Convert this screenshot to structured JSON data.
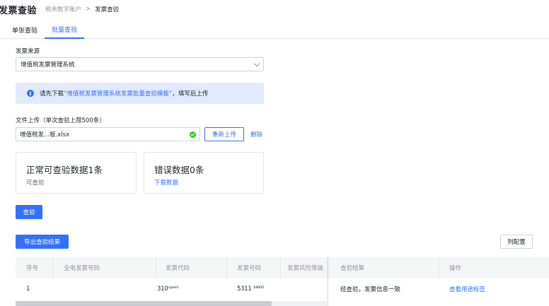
{
  "header": {
    "title": "发票查验",
    "breadcrumb_parent": "税务数字账户",
    "breadcrumb_sep": ">",
    "breadcrumb_current": "发票查验"
  },
  "tabs": [
    {
      "label": "单张查验",
      "active": false
    },
    {
      "label": "批量查验",
      "active": true
    }
  ],
  "form": {
    "source_label": "发票来源",
    "source_value": "增值税发票管理系统",
    "notice_prefix": "请先下载",
    "notice_link": "“增值税发票管理系统发票批量查验模板”",
    "notice_suffix": "，填写后上传",
    "upload_label": "文件上传（单次查验上限500条）",
    "file_name": "增值税发...板.xlsx",
    "reupload_label": "重新上传",
    "delete_label": "删除"
  },
  "summary": {
    "valid_title": "正常可查验数据1条",
    "valid_sub": "可查验",
    "error_title": "错误数据0条",
    "error_sub": "下载数据"
  },
  "actions": {
    "check_label": "查验",
    "export_label": "导出查验结果",
    "column_config_label": "列配置"
  },
  "table": {
    "columns": [
      "序号",
      "全电发票号码",
      "发票代码",
      "发票号码",
      "发票风险等级",
      "查验结果",
      "操作"
    ],
    "rows": [
      {
        "index": "1",
        "full_number": "",
        "code": "310ⁿʲᵃᵉˡ'ᵎ",
        "number": "5311 ¹⁹⁰⁰⁰",
        "risk": "",
        "result": "经查验，发票信息一致",
        "action": "查看用途标签"
      }
    ]
  },
  "colors": {
    "primary": "#3370ff",
    "notice_bg": "#e1eaff",
    "success": "#34c724"
  },
  "icons": [
    "info-icon",
    "chevron-down-icon",
    "check-circle-icon"
  ]
}
